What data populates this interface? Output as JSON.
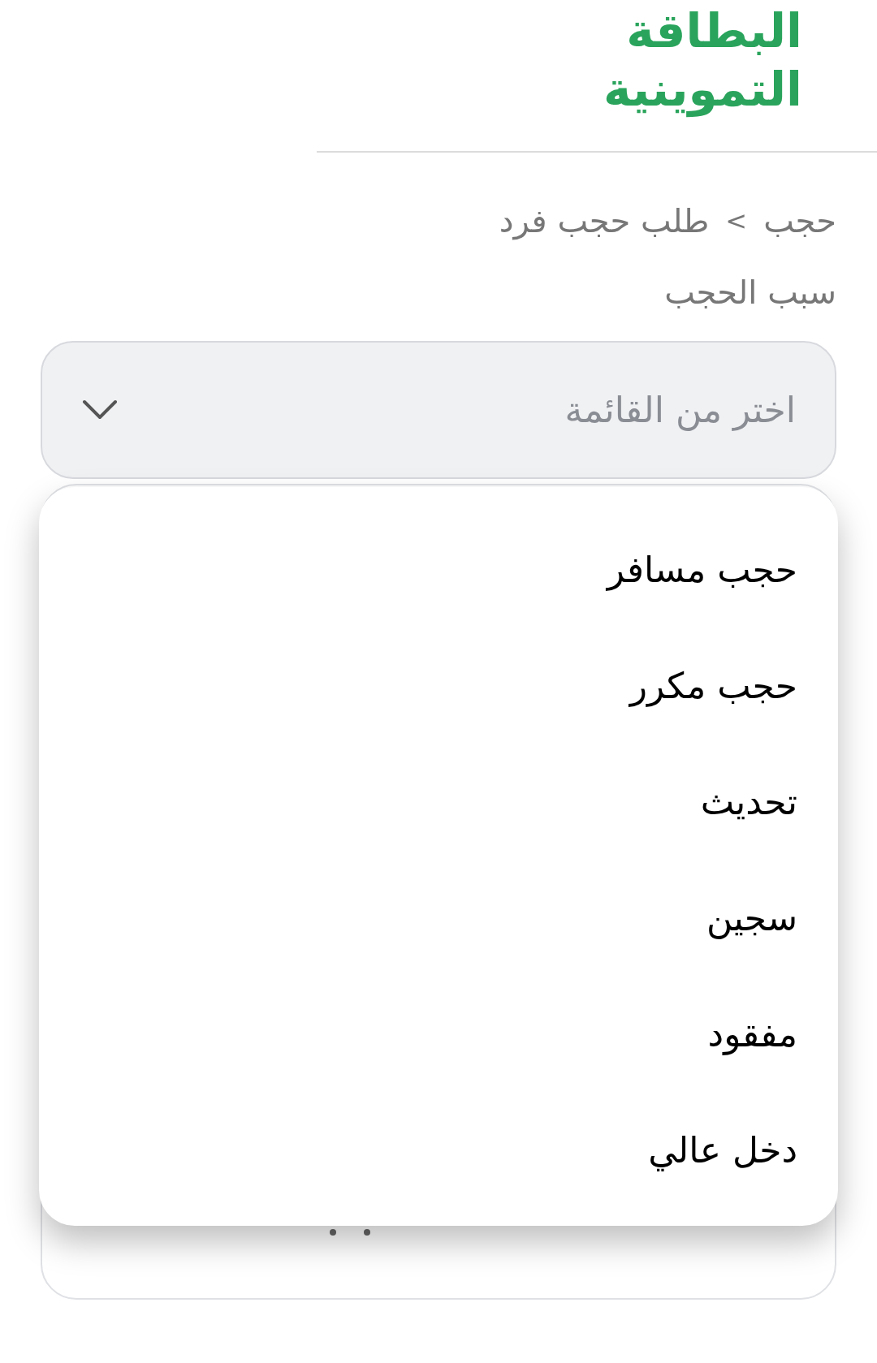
{
  "header": {
    "title_lines": [
      "البطاقة",
      "التموينية"
    ]
  },
  "breadcrumb": {
    "items": [
      "حجب",
      "طلب حجب فرد"
    ],
    "separator": ">"
  },
  "field": {
    "label": "سبب الحجب",
    "placeholder": "اختر من القائمة",
    "expanded": true
  },
  "options": [
    {
      "label": "حجب مسافر"
    },
    {
      "label": "حجب مكرر"
    },
    {
      "label": "تحديث"
    },
    {
      "label": "سجين"
    },
    {
      "label": "مفقود"
    },
    {
      "label": "دخل عالي"
    }
  ]
}
